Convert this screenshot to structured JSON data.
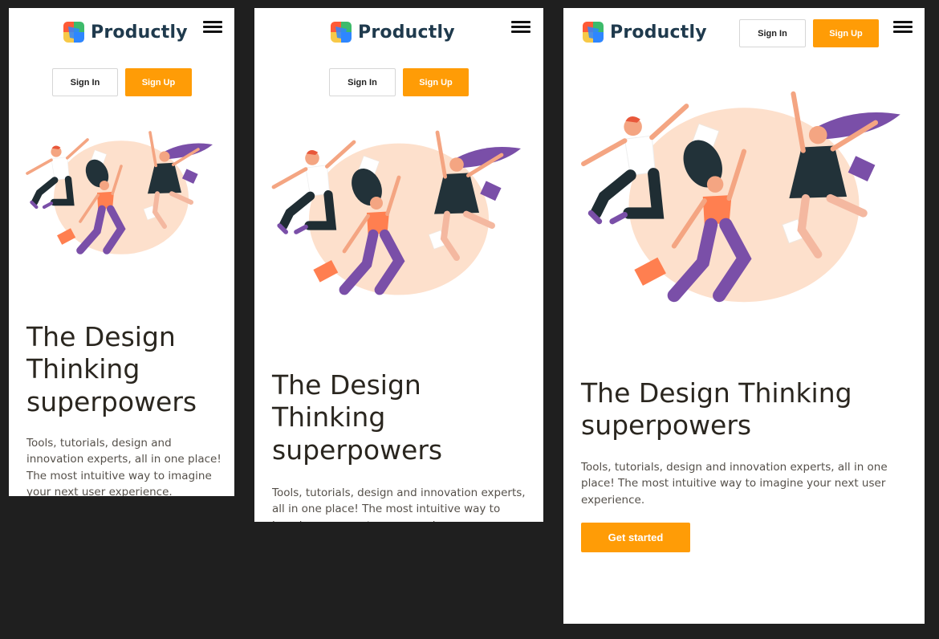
{
  "brand": {
    "name": "Productly"
  },
  "auth": {
    "sign_in": "Sign In",
    "sign_up": "Sign Up"
  },
  "hero": {
    "title_line1": "The Design",
    "title_line2": "Thinking",
    "title_line3": "superpowers",
    "title_wide_line1": "The Design Thinking",
    "title_wide_line2": "superpowers",
    "description": "Tools, tutorials, design and innovation experts, all in one place! The most intuitive way to imagine your next user experience.",
    "cta": "Get started"
  },
  "colors": {
    "accent": "#ff9c06",
    "text": "#2a261f",
    "brand_text": "#1f3a4d",
    "blob": "#fde0cc"
  },
  "icons": [
    "logo-icon",
    "hamburger-menu-icon"
  ]
}
